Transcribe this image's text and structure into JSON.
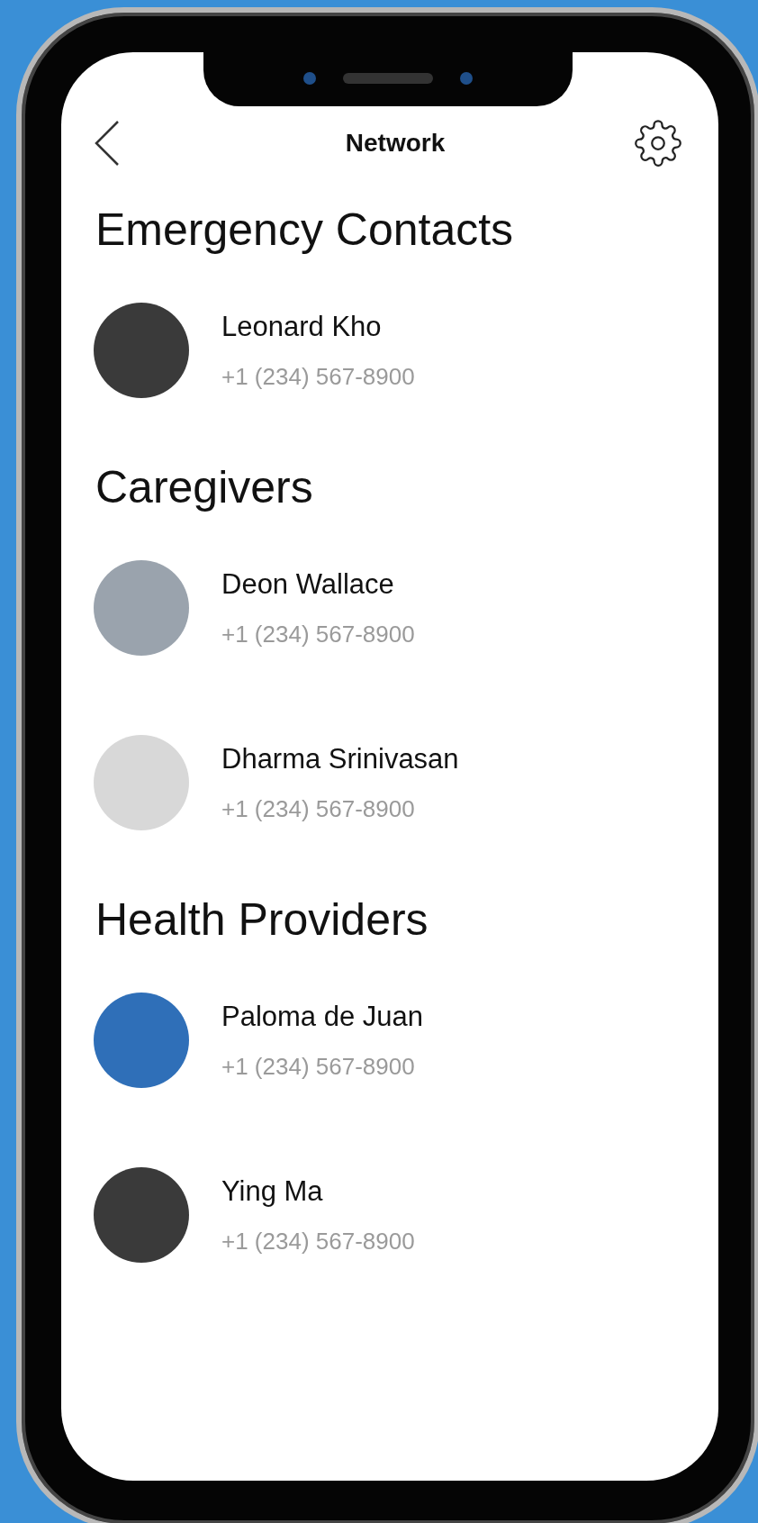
{
  "header": {
    "title": "Network"
  },
  "sections": [
    {
      "title": "Emergency Contacts",
      "contacts": [
        {
          "name": "Leonard Kho",
          "phone": "+1 (234) 567-8900"
        }
      ]
    },
    {
      "title": "Caregivers",
      "contacts": [
        {
          "name": "Deon Wallace",
          "phone": "+1 (234) 567-8900"
        },
        {
          "name": "Dharma Srinivasan",
          "phone": "+1 (234) 567-8900"
        }
      ]
    },
    {
      "title": "Health Providers",
      "contacts": [
        {
          "name": "Paloma de Juan",
          "phone": "+1 (234) 567-8900"
        },
        {
          "name": "Ying Ma",
          "phone": "+1 (234) 567-8900"
        }
      ]
    }
  ]
}
